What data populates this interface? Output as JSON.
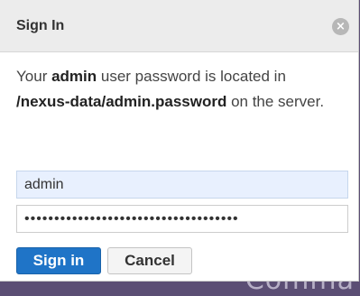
{
  "background": {
    "partial_text": "Comma"
  },
  "dialog": {
    "title": "Sign In",
    "close_icon": "×",
    "message": {
      "part1": "Your ",
      "user": "admin",
      "part2": " user password is located in ",
      "path": "/nexus-data/admin.password",
      "part3": " on the server."
    },
    "username": {
      "value": "admin"
    },
    "password": {
      "value": "••••••••••••••••••••••••••••••••••••"
    },
    "buttons": {
      "sign_in": "Sign in",
      "cancel": "Cancel"
    }
  },
  "colors": {
    "primary": "#1f74c7",
    "autofill": "#e8f0fe",
    "header": "#ececec"
  }
}
